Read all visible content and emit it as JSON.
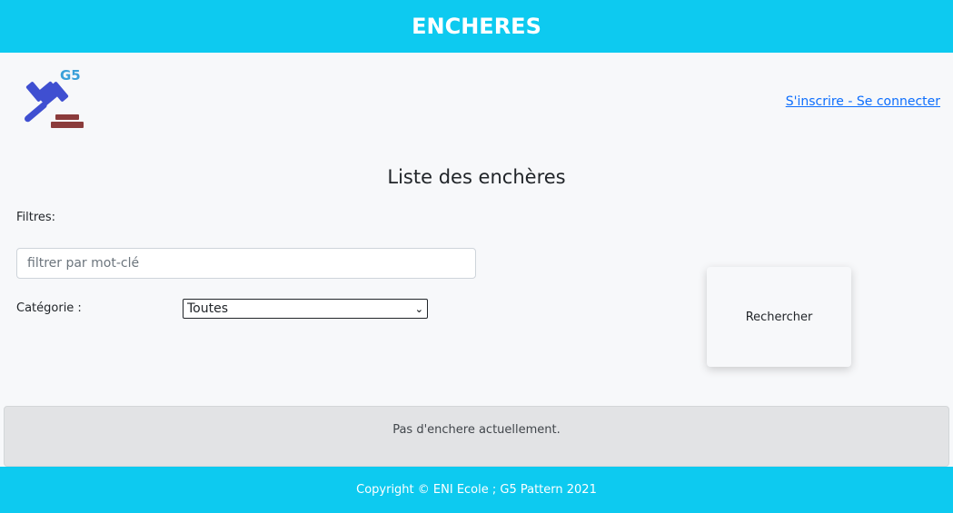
{
  "header": {
    "title": "ENCHERES"
  },
  "logo": {
    "text": "G5",
    "icon": "gavel-icon"
  },
  "auth": {
    "link_label": "S'inscrire - Se connecter"
  },
  "main": {
    "title": "Liste des enchères",
    "filters_label": "Filtres:",
    "search": {
      "value": "",
      "placeholder": "filtrer par mot-clé"
    },
    "category": {
      "label": "Catégorie :",
      "selected": "Toutes"
    },
    "search_button": "Rechercher",
    "empty_message": "Pas d'enchere actuellement."
  },
  "footer": {
    "text": "Copyright © ENI Ecole ; G5 Pattern 2021"
  },
  "colors": {
    "header_bg": "#0dcaf0",
    "link": "#0d6efd",
    "gavel_head": "#3f4fd1",
    "gavel_base": "#8b3b3b",
    "logo_text": "#3aa0d9"
  }
}
